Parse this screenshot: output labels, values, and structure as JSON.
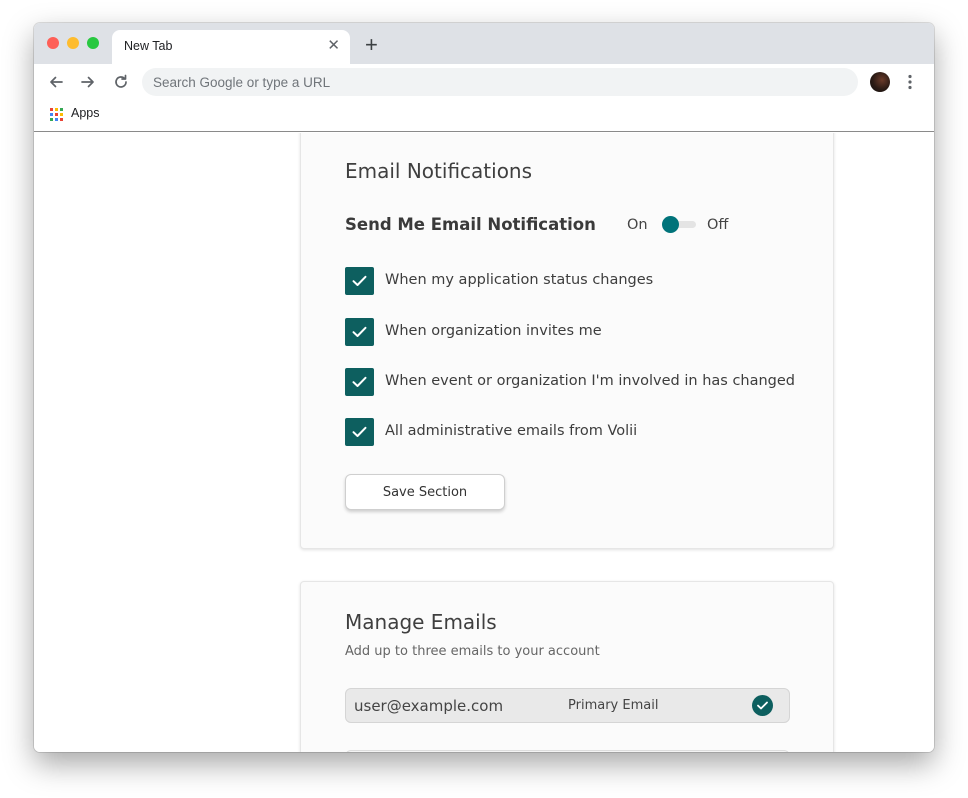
{
  "browser": {
    "tab_title": "New Tab",
    "close_glyph": "✕",
    "new_tab_glyph": "+",
    "omnibox_placeholder": "Search Google or type a URL",
    "bookmarks": {
      "apps_label": "Apps"
    }
  },
  "email_notifications": {
    "title": "Email Notifications",
    "toggle_heading": "Send Me Email Notification",
    "toggle_on_label": "On",
    "toggle_off_label": "Off",
    "options": [
      {
        "label": "When my application status changes",
        "checked": true
      },
      {
        "label": "When organization invites me",
        "checked": true
      },
      {
        "label": "When event or organization I'm involved in has changed",
        "checked": true
      },
      {
        "label": "All administrative emails from Volii",
        "checked": true
      }
    ],
    "save_label": "Save Section"
  },
  "manage_emails": {
    "title": "Manage Emails",
    "subtitle": "Add up to three emails to your account",
    "emails": [
      {
        "address": "user@example.com",
        "tag": "Primary Email",
        "verified": true
      }
    ]
  },
  "colors": {
    "accent": "#0d5f5f",
    "toggle_knob": "#00737a"
  },
  "icons": [
    "back-arrow-icon",
    "forward-arrow-icon",
    "reload-icon",
    "apps-grid-icon",
    "kebab-menu-icon",
    "checkmark-icon",
    "close-icon",
    "plus-icon"
  ]
}
